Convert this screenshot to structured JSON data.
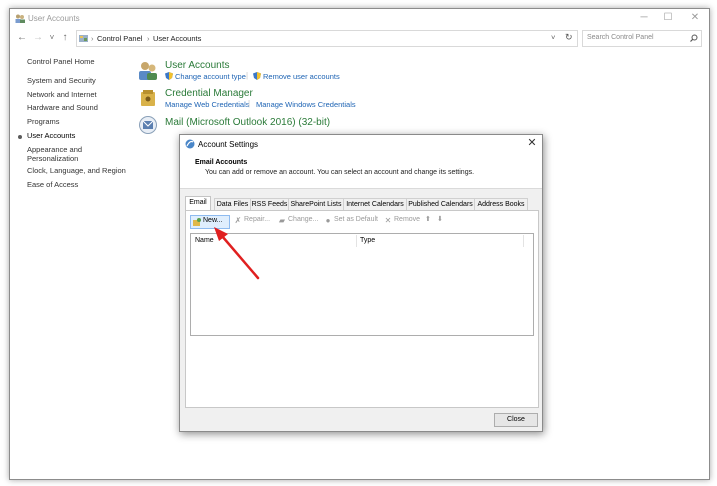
{
  "window": {
    "title": "User Accounts",
    "minimize": "─",
    "maximize": "☐",
    "close": "✕"
  },
  "address": {
    "back": "←",
    "forward": "→",
    "recent": "˅",
    "up": "↑",
    "breadcrumb": [
      "Control Panel",
      "User Accounts"
    ],
    "crumb_sep": "›",
    "refresh": "↻",
    "dropdown": "˅",
    "search_placeholder": "Search Control Panel"
  },
  "left_nav": {
    "home": "Control Panel Home",
    "items": [
      "System and Security",
      "Network and Internet",
      "Hardware and Sound",
      "Programs",
      "User Accounts",
      "Appearance and",
      "Personalization",
      "Clock, Language, and Region",
      "Ease of Access"
    ]
  },
  "main": {
    "user_accounts": {
      "heading": "User Accounts",
      "links": [
        "Change account type",
        "Remove user accounts"
      ]
    },
    "credential_manager": {
      "heading": "Credential Manager",
      "links": [
        "Manage Web Credentials",
        "Manage Windows Credentials"
      ]
    },
    "mail": {
      "heading": "Mail (Microsoft Outlook 2016) (32-bit)"
    },
    "link_sep": "|"
  },
  "dialog": {
    "title": "Account Settings",
    "close": "✕",
    "section_title": "Email Accounts",
    "description": "You can add or remove an account. You can select an account and change its settings.",
    "tabs": [
      "Email",
      "Data Files",
      "RSS Feeds",
      "SharePoint Lists",
      "Internet Calendars",
      "Published Calendars",
      "Address Books"
    ],
    "toolbar": {
      "new": "New...",
      "repair": "Repair...",
      "change": "Change...",
      "set_default": "Set as Default",
      "remove": "Remove",
      "up": "⬆",
      "down": "⬇"
    },
    "columns": [
      "Name",
      "Type"
    ],
    "close_button": "Close"
  },
  "colors": {
    "heading_green": "#2a7a38",
    "link_blue": "#1e64b4",
    "annotation_red": "#e02020"
  }
}
